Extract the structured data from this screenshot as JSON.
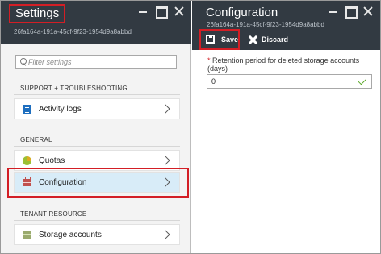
{
  "settings_blade": {
    "title": "Settings",
    "subtitle": "26fa164a-191a-45cf-9f23-1954d9a8abbd",
    "filter_placeholder": "Filter settings",
    "sections": [
      {
        "header": "SUPPORT + TROUBLESHOOTING",
        "items": [
          {
            "label": "Activity logs",
            "icon": "activity-log-icon"
          }
        ]
      },
      {
        "header": "GENERAL",
        "items": [
          {
            "label": "Quotas",
            "icon": "quotas-icon"
          },
          {
            "label": "Configuration",
            "icon": "configuration-icon",
            "selected": true
          }
        ]
      },
      {
        "header": "TENANT RESOURCE",
        "items": [
          {
            "label": "Storage accounts",
            "icon": "storage-accounts-icon"
          }
        ]
      }
    ]
  },
  "configuration_blade": {
    "title": "Configuration",
    "subtitle": "26fa164a-191a-45cf-9f23-1954d9a8abbd",
    "commands": {
      "save": "Save",
      "discard": "Discard"
    },
    "field": {
      "required_marker": "*",
      "label": "Retention period for deleted storage accounts (days)",
      "value": "0",
      "valid": true
    }
  },
  "colors": {
    "header_bg": "#323a42",
    "highlight_border": "#d31e25",
    "selected_item_bg": "#d8ecf8",
    "valid_check": "#5ba829"
  }
}
